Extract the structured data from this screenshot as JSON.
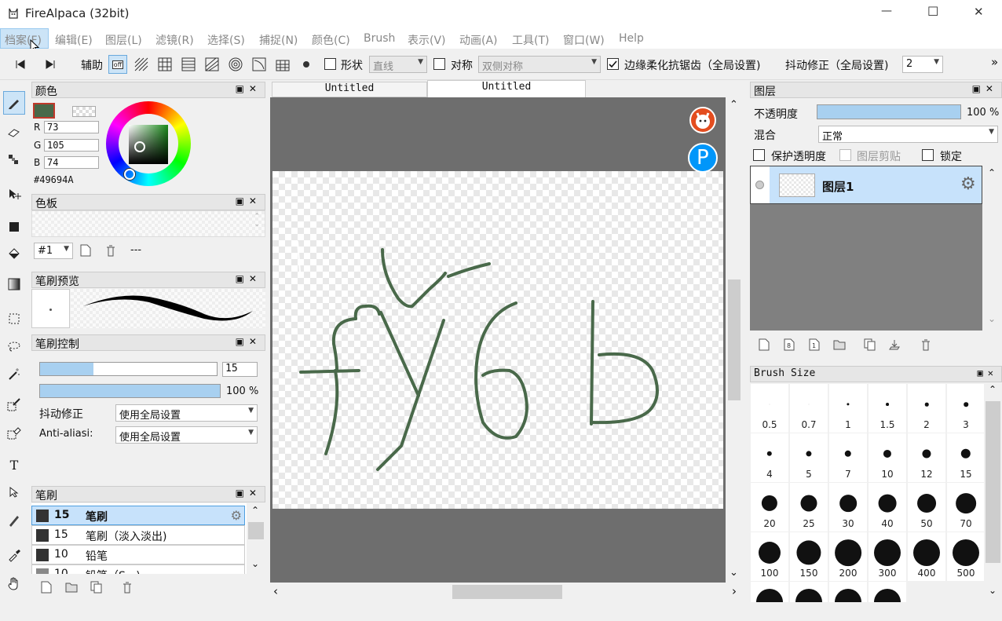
{
  "window": {
    "title": "FireAlpaca (32bit)",
    "min_glyph": "—",
    "max_glyph": "☐",
    "close_glyph": "✕"
  },
  "menu": [
    "档案(F)",
    "编辑(E)",
    "图层(L)",
    "滤镜(R)",
    "选择(S)",
    "捕捉(N)",
    "颜色(C)",
    "Brush",
    "表示(V)",
    "动画(A)",
    "工具(T)",
    "窗口(W)",
    "Help"
  ],
  "toolbar": {
    "assist_label": "辅助",
    "snap_off": "off",
    "shape_label": "形状",
    "shape_value": "直线",
    "symmetry_label": "对称",
    "symmetry_value": "双侧对称",
    "antialias_label": "边缘柔化抗锯齿（全局设置)",
    "stabilizer_label": "抖动修正（全局设置)",
    "stabilizer_value": "2",
    "overflow": "»"
  },
  "color_panel": {
    "title": "颜色",
    "r_label": "R",
    "r": "73",
    "g_label": "G",
    "g": "105",
    "b_label": "B",
    "b": "74",
    "hex": "#49694A",
    "current_color": "#49694a"
  },
  "palette_panel": {
    "title": "色板",
    "slot": "#1",
    "name": "---"
  },
  "brush_preview_panel": {
    "title": "笔刷预览"
  },
  "brush_control_panel": {
    "title": "笔刷控制",
    "size": "15",
    "size_fraction": 0.3,
    "opacity": "100 %",
    "opacity_fraction": 1.0,
    "stabilizer_label": "抖动修正",
    "stabilizer_value": "使用全局设置",
    "antialias_label": "Anti-aliasi:",
    "antialias_value": "使用全局设置"
  },
  "brush_panel": {
    "title": "笔刷",
    "items": [
      {
        "size": "15",
        "name": "笔刷"
      },
      {
        "size": "15",
        "name": "笔刷（淡入淡出)"
      },
      {
        "size": "10",
        "name": "铅笔"
      },
      {
        "size": "10",
        "name": "铅笔（S...)"
      }
    ]
  },
  "canvas": {
    "tabs": [
      "Untitled",
      "Untitled"
    ],
    "active_tab": 1,
    "stroke_color": "#49694a"
  },
  "layers_panel": {
    "title": "图层",
    "opacity_label": "不透明度",
    "opacity": "100 %",
    "opacity_fraction": 1.0,
    "blend_label": "混合",
    "blend_value": "正常",
    "protect_alpha": "保护透明度",
    "clipping": "图层剪贴",
    "lock": "锁定",
    "layers": [
      {
        "name": "图层1"
      }
    ]
  },
  "brush_size_panel": {
    "title": "Brush Size",
    "sizes": [
      "0.5",
      "0.7",
      "1",
      "1.5",
      "2",
      "3",
      "4",
      "5",
      "7",
      "10",
      "12",
      "15",
      "20",
      "25",
      "30",
      "40",
      "50",
      "70",
      "100",
      "150",
      "200",
      "300",
      "400",
      "500"
    ]
  },
  "colors": {
    "accent": "#cce4f7",
    "panel_header": "#e6e6e6",
    "canvas_bg": "#6e6e6e",
    "sel_blue": "#c7e2fb"
  }
}
